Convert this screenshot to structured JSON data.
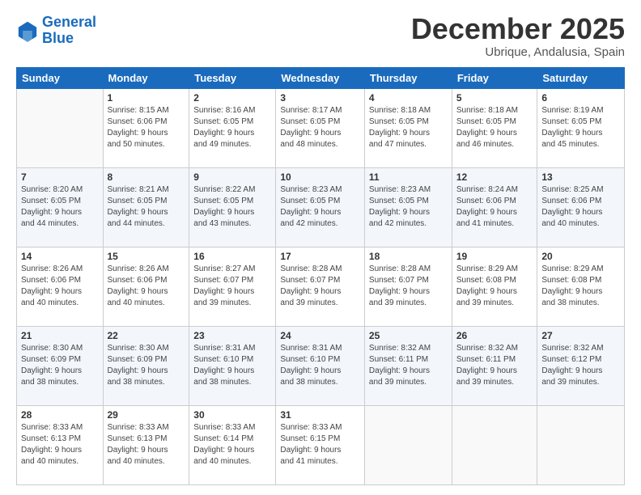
{
  "logo": {
    "line1": "General",
    "line2": "Blue"
  },
  "title": "December 2025",
  "subtitle": "Ubrique, Andalusia, Spain",
  "headers": [
    "Sunday",
    "Monday",
    "Tuesday",
    "Wednesday",
    "Thursday",
    "Friday",
    "Saturday"
  ],
  "weeks": [
    [
      {
        "day": "",
        "info": ""
      },
      {
        "day": "1",
        "info": "Sunrise: 8:15 AM\nSunset: 6:06 PM\nDaylight: 9 hours\nand 50 minutes."
      },
      {
        "day": "2",
        "info": "Sunrise: 8:16 AM\nSunset: 6:05 PM\nDaylight: 9 hours\nand 49 minutes."
      },
      {
        "day": "3",
        "info": "Sunrise: 8:17 AM\nSunset: 6:05 PM\nDaylight: 9 hours\nand 48 minutes."
      },
      {
        "day": "4",
        "info": "Sunrise: 8:18 AM\nSunset: 6:05 PM\nDaylight: 9 hours\nand 47 minutes."
      },
      {
        "day": "5",
        "info": "Sunrise: 8:18 AM\nSunset: 6:05 PM\nDaylight: 9 hours\nand 46 minutes."
      },
      {
        "day": "6",
        "info": "Sunrise: 8:19 AM\nSunset: 6:05 PM\nDaylight: 9 hours\nand 45 minutes."
      }
    ],
    [
      {
        "day": "7",
        "info": "Sunrise: 8:20 AM\nSunset: 6:05 PM\nDaylight: 9 hours\nand 44 minutes."
      },
      {
        "day": "8",
        "info": "Sunrise: 8:21 AM\nSunset: 6:05 PM\nDaylight: 9 hours\nand 44 minutes."
      },
      {
        "day": "9",
        "info": "Sunrise: 8:22 AM\nSunset: 6:05 PM\nDaylight: 9 hours\nand 43 minutes."
      },
      {
        "day": "10",
        "info": "Sunrise: 8:23 AM\nSunset: 6:05 PM\nDaylight: 9 hours\nand 42 minutes."
      },
      {
        "day": "11",
        "info": "Sunrise: 8:23 AM\nSunset: 6:05 PM\nDaylight: 9 hours\nand 42 minutes."
      },
      {
        "day": "12",
        "info": "Sunrise: 8:24 AM\nSunset: 6:06 PM\nDaylight: 9 hours\nand 41 minutes."
      },
      {
        "day": "13",
        "info": "Sunrise: 8:25 AM\nSunset: 6:06 PM\nDaylight: 9 hours\nand 40 minutes."
      }
    ],
    [
      {
        "day": "14",
        "info": "Sunrise: 8:26 AM\nSunset: 6:06 PM\nDaylight: 9 hours\nand 40 minutes."
      },
      {
        "day": "15",
        "info": "Sunrise: 8:26 AM\nSunset: 6:06 PM\nDaylight: 9 hours\nand 40 minutes."
      },
      {
        "day": "16",
        "info": "Sunrise: 8:27 AM\nSunset: 6:07 PM\nDaylight: 9 hours\nand 39 minutes."
      },
      {
        "day": "17",
        "info": "Sunrise: 8:28 AM\nSunset: 6:07 PM\nDaylight: 9 hours\nand 39 minutes."
      },
      {
        "day": "18",
        "info": "Sunrise: 8:28 AM\nSunset: 6:07 PM\nDaylight: 9 hours\nand 39 minutes."
      },
      {
        "day": "19",
        "info": "Sunrise: 8:29 AM\nSunset: 6:08 PM\nDaylight: 9 hours\nand 39 minutes."
      },
      {
        "day": "20",
        "info": "Sunrise: 8:29 AM\nSunset: 6:08 PM\nDaylight: 9 hours\nand 38 minutes."
      }
    ],
    [
      {
        "day": "21",
        "info": "Sunrise: 8:30 AM\nSunset: 6:09 PM\nDaylight: 9 hours\nand 38 minutes."
      },
      {
        "day": "22",
        "info": "Sunrise: 8:30 AM\nSunset: 6:09 PM\nDaylight: 9 hours\nand 38 minutes."
      },
      {
        "day": "23",
        "info": "Sunrise: 8:31 AM\nSunset: 6:10 PM\nDaylight: 9 hours\nand 38 minutes."
      },
      {
        "day": "24",
        "info": "Sunrise: 8:31 AM\nSunset: 6:10 PM\nDaylight: 9 hours\nand 38 minutes."
      },
      {
        "day": "25",
        "info": "Sunrise: 8:32 AM\nSunset: 6:11 PM\nDaylight: 9 hours\nand 39 minutes."
      },
      {
        "day": "26",
        "info": "Sunrise: 8:32 AM\nSunset: 6:11 PM\nDaylight: 9 hours\nand 39 minutes."
      },
      {
        "day": "27",
        "info": "Sunrise: 8:32 AM\nSunset: 6:12 PM\nDaylight: 9 hours\nand 39 minutes."
      }
    ],
    [
      {
        "day": "28",
        "info": "Sunrise: 8:33 AM\nSunset: 6:13 PM\nDaylight: 9 hours\nand 40 minutes."
      },
      {
        "day": "29",
        "info": "Sunrise: 8:33 AM\nSunset: 6:13 PM\nDaylight: 9 hours\nand 40 minutes."
      },
      {
        "day": "30",
        "info": "Sunrise: 8:33 AM\nSunset: 6:14 PM\nDaylight: 9 hours\nand 40 minutes."
      },
      {
        "day": "31",
        "info": "Sunrise: 8:33 AM\nSunset: 6:15 PM\nDaylight: 9 hours\nand 41 minutes."
      },
      {
        "day": "",
        "info": ""
      },
      {
        "day": "",
        "info": ""
      },
      {
        "day": "",
        "info": ""
      }
    ]
  ]
}
